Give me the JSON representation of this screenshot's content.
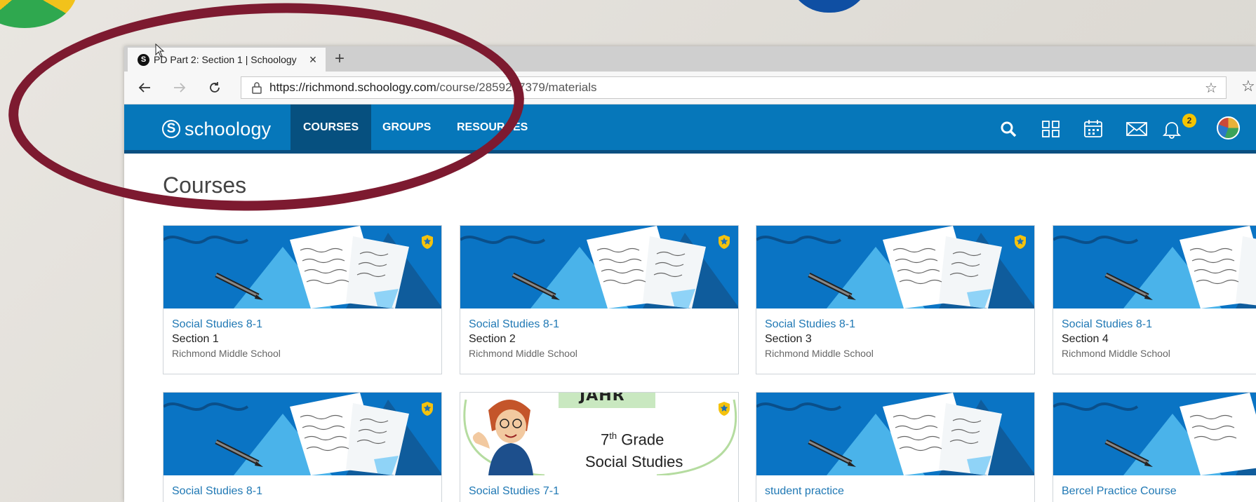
{
  "browser": {
    "tab_title": "PD Part 2: Section 1 | Schoology",
    "favicon_letter": "S",
    "close_glyph": "×",
    "newtab_glyph": "+",
    "url_host": "https://richmond.schoology.com",
    "url_path": "/course/2859257379/materials"
  },
  "nav": {
    "logo_text": "schoology",
    "logo_letter": "S",
    "links": [
      "COURSES",
      "GROUPS",
      "RESOURCES"
    ],
    "notification_count": "2",
    "colors": {
      "bar": "#0677ba",
      "active": "#06507f",
      "annotation": "#7d1a30"
    }
  },
  "page": {
    "title": "Courses"
  },
  "courses": [
    {
      "course": "Social Studies 8-1",
      "section": "Section 1",
      "school": "Richmond Middle School",
      "image": "books-banner"
    },
    {
      "course": "Social Studies 8-1",
      "section": "Section 2",
      "school": "Richmond Middle School",
      "image": "books-banner"
    },
    {
      "course": "Social Studies 8-1",
      "section": "Section 3",
      "school": "Richmond Middle School",
      "image": "books-banner"
    },
    {
      "course": "Social Studies 8-1",
      "section": "Section 4",
      "school": "Richmond Middle School",
      "image": "books-banner"
    },
    {
      "course": "Social Studies 8-1",
      "image": "books-banner"
    },
    {
      "course": "Social Studies 7-1",
      "image": "grade7-banner",
      "banner_top": "JAHR",
      "banner_grade": "7",
      "banner_sup": "th",
      "banner_grade_word": "Grade",
      "banner_subject": "Social Studies"
    },
    {
      "course": "student practice",
      "image": "books-banner"
    },
    {
      "course": "Bercel Practice Course",
      "image": "books-banner"
    }
  ]
}
